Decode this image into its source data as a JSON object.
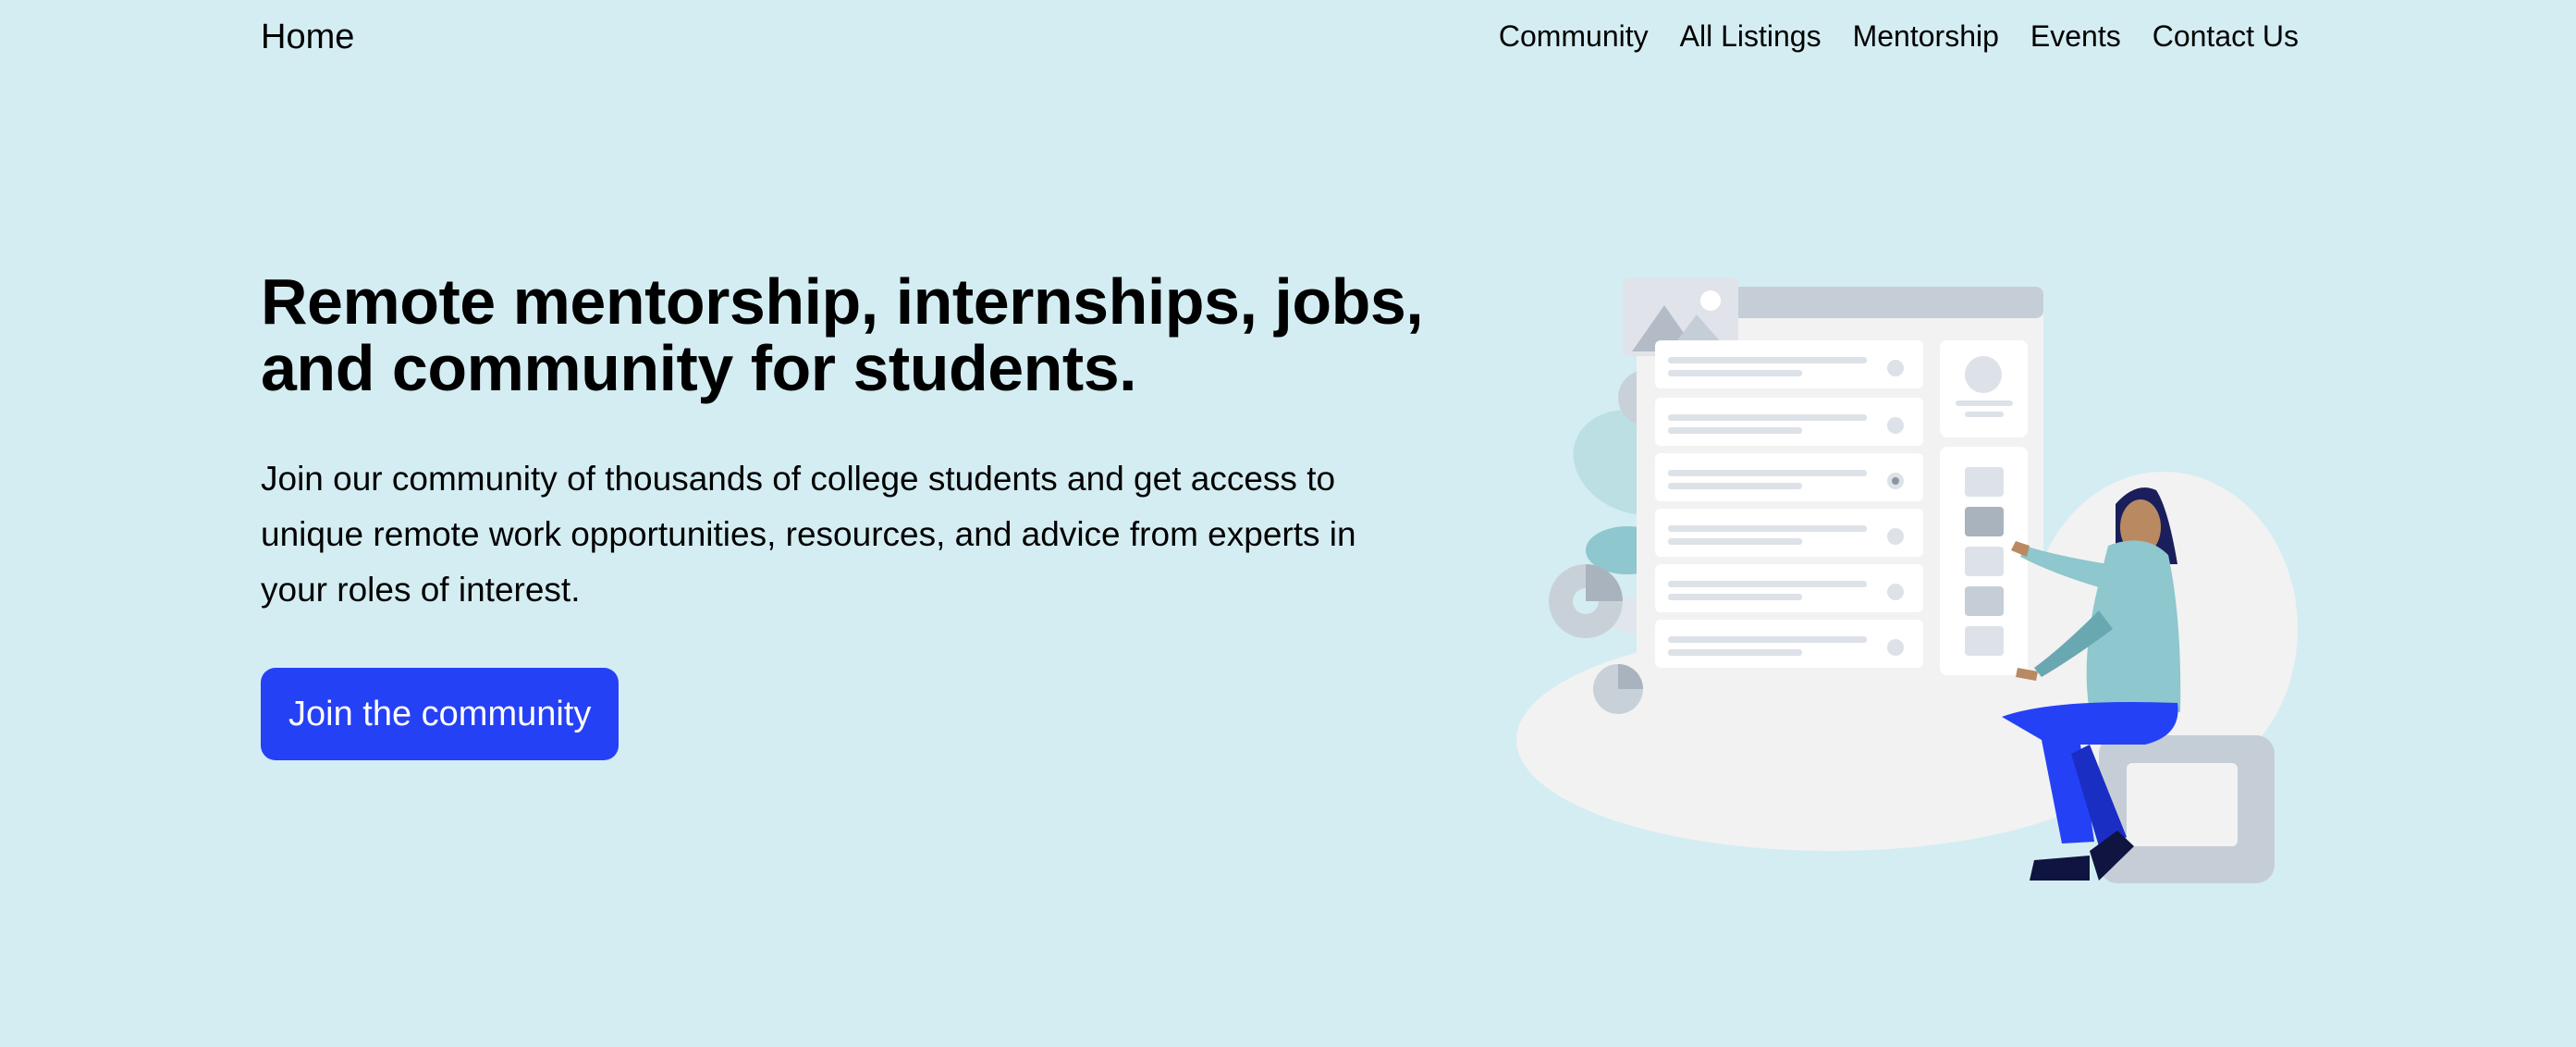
{
  "nav": {
    "brand": "Home",
    "links": [
      "Community",
      "All Listings",
      "Mentorship",
      "Events",
      "Contact Us"
    ]
  },
  "hero": {
    "title": "Remote mentorship, internships, jobs, and community for students.",
    "subtitle": "Join our community of thousands of college students and get access to unique remote work opportunities, resources, and advice from experts in your roles of interest.",
    "cta_label": "Join the community"
  },
  "illustration": {
    "icon": "woman-browsing-listings-illustration"
  },
  "colors": {
    "background": "#d4edf2",
    "accent": "#2541f6",
    "text": "#000000"
  }
}
